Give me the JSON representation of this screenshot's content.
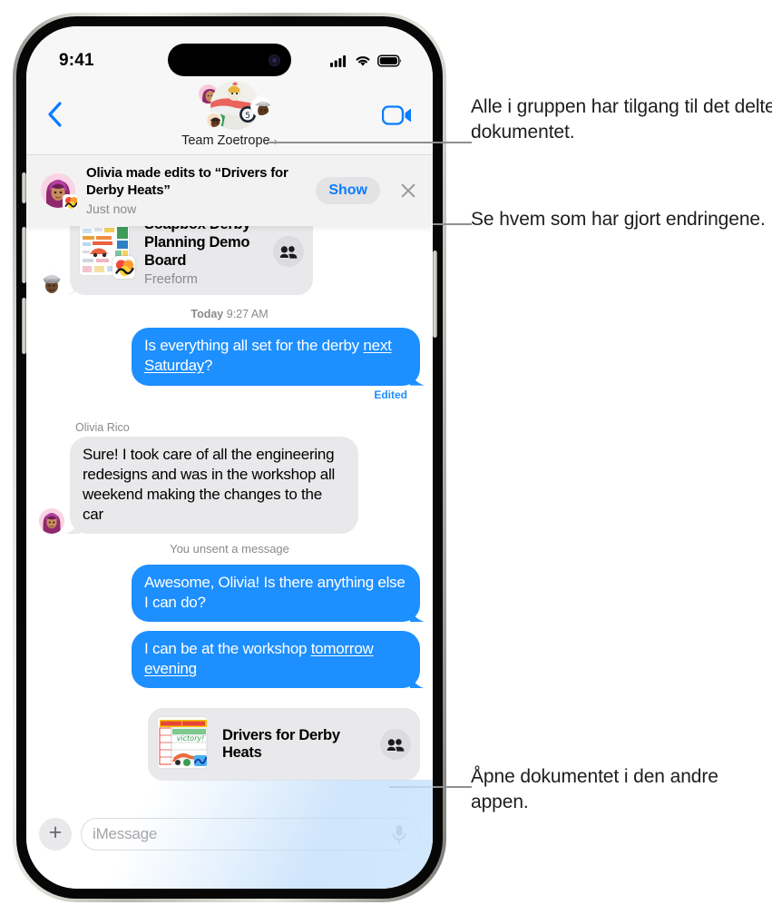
{
  "statusbar": {
    "time": "9:41",
    "icons": [
      "cellular-signal-icon",
      "wifi-icon",
      "battery-icon"
    ]
  },
  "nav": {
    "back_icon": "chevron-left-icon",
    "video_icon": "facetime-video-icon",
    "group_name": "Team Zoetrope",
    "group_chevron": "›"
  },
  "banner": {
    "title": "Olivia made edits to “Drivers for Derby Heats”",
    "subtitle": "Just now",
    "show_label": "Show",
    "close_icon": "close-icon",
    "avatar": "olivia-memoji-avatar",
    "app_badge": "freeform-app-icon"
  },
  "conversation": {
    "freeform_attachment": {
      "title": "Soapbox Derby Planning Demo Board",
      "subtitle": "Freeform",
      "thumbnail": "freeform-board-thumbnail",
      "app_badge": "freeform-app-icon",
      "participants_icon": "two-people-icon",
      "sender_avatar": "knight-memoji-avatar"
    },
    "timestamp": "Today 9:27 AM",
    "timestamp_day": "Today",
    "timestamp_time": "9:27 AM",
    "messages": [
      {
        "side": "outgoing",
        "text_plain": "Is everything all set for the derby next Saturday?",
        "text_before": "Is everything all set for the derby ",
        "text_link": "next Saturday",
        "text_after": "?",
        "status": "Edited"
      },
      {
        "side": "incoming",
        "sender": "Olivia Rico",
        "text_plain": "Sure! I took care of all the engineering redesigns and was in the workshop all weekend making the changes to the car",
        "avatar": "olivia-memoji-avatar"
      },
      {
        "side": "system",
        "text_plain": "You unsent a message"
      },
      {
        "side": "outgoing",
        "text_plain": "Awesome, Olivia! Is there anything else I can do?"
      },
      {
        "side": "outgoing",
        "text_before": "I can be at the workshop ",
        "text_link": "tomorrow evening",
        "text_after": "",
        "text_plain": "I can be at the workshop tomorrow evening"
      }
    ],
    "numbers_attachment": {
      "title": "Drivers for Derby Heats",
      "thumbnail": "numbers-spreadsheet-thumbnail",
      "participants_icon": "two-people-icon"
    }
  },
  "input": {
    "plus_icon": "plus-icon",
    "placeholder": "iMessage",
    "value": "",
    "mic_icon": "microphone-icon"
  },
  "callouts": [
    {
      "id": "callout-group-access",
      "text": "Alle i gruppen har tilgang til det delte dokumentet."
    },
    {
      "id": "callout-see-changes",
      "text": "Se hvem som har gjort endringene."
    },
    {
      "id": "callout-open-document",
      "text": "Åpne dokumentet i den andre appen."
    }
  ],
  "colors": {
    "accent_blue": "#1d8fff",
    "link_blue": "#0a7cff",
    "bubble_gray": "#e9e9eb",
    "banner_bg": "#f2f2f2",
    "nav_bg": "#f7f7f7",
    "secondary_text": "#8a8a8e"
  }
}
